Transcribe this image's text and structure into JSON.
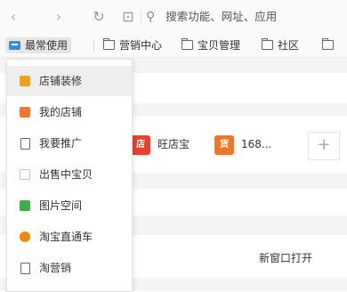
{
  "toolbar": {
    "back_glyph": "‹",
    "forward_glyph": "›",
    "reload_glyph": "↻",
    "snapshot_glyph": "⊡",
    "search_glyph": "⚲",
    "address_placeholder": "搜索功能、网址、应用"
  },
  "bookmarks": {
    "items": [
      {
        "label": "最常使用",
        "icon": "tray-icon",
        "active": true
      },
      {
        "label": "营销中心",
        "icon": "folder-icon"
      },
      {
        "label": "宝贝管理",
        "icon": "folder-icon"
      },
      {
        "label": "社区",
        "icon": "folder-icon"
      }
    ]
  },
  "apps": [
    {
      "label": "旺店宝",
      "icon": "wangdianbao-icon",
      "badge": "店",
      "color": "#e8412b"
    },
    {
      "label": "168...",
      "icon": "168-app-icon",
      "badge": "货",
      "color": "#f0762a"
    }
  ],
  "plus_label": "+",
  "new_window_label": "新窗口打开",
  "menu": {
    "items": [
      {
        "label": "店铺装修",
        "icon": "store-decoration-icon",
        "color": "#f0a020"
      },
      {
        "label": "我的店铺",
        "icon": "my-store-icon",
        "color": "#f07830"
      },
      {
        "label": "我要推广",
        "icon": "document-icon",
        "color": "#666666"
      },
      {
        "label": "出售中宝贝",
        "icon": "on-sale-icon",
        "color": "#b8c8dc"
      },
      {
        "label": "图片空间",
        "icon": "image-space-icon",
        "color": "#3cb04a"
      },
      {
        "label": "淘宝直通车",
        "icon": "taobao-ztc-icon",
        "color": "#f08a00"
      },
      {
        "label": "淘营销",
        "icon": "document-icon",
        "color": "#666666"
      }
    ]
  }
}
